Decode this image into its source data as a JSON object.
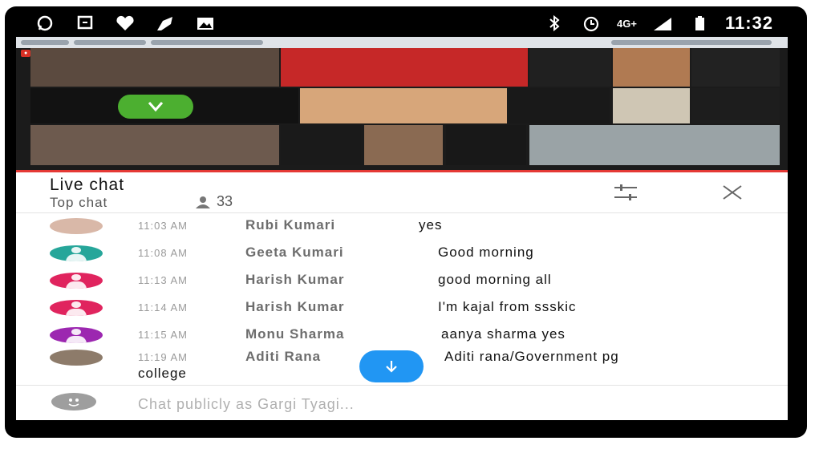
{
  "status_bar": {
    "time": "11:32",
    "network": "4G+",
    "left_icons": [
      "whatsapp-icon",
      "message-icon",
      "heart-icon",
      "cleaner-icon",
      "gallery-icon"
    ],
    "right_icons": [
      "bluetooth-icon",
      "alarm-icon",
      "signal-icon",
      "battery-icon"
    ]
  },
  "chat": {
    "title": "Live chat",
    "mode": "Top chat",
    "viewer_count": "33",
    "input_placeholder": "Chat publicly as Gargi Tyagi...",
    "messages": [
      {
        "time": "11:03 AM",
        "author": "Rubi Kumari",
        "text": "yes",
        "avatar_color": "#d9b8a8"
      },
      {
        "time": "11:08 AM",
        "author": "Geeta Kumari",
        "text": "Good morning",
        "avatar_color": "#26a69a"
      },
      {
        "time": "11:13 AM",
        "author": "Harish Kumar",
        "text": "good morning all",
        "avatar_color": "#e0245e"
      },
      {
        "time": "11:14 AM",
        "author": "Harish Kumar",
        "text": "I'm kajal from ssskic",
        "avatar_color": "#e0245e"
      },
      {
        "time": "11:15 AM",
        "author": "Monu Sharma",
        "text": "aanya sharma yes",
        "avatar_color": "#9c27b0"
      },
      {
        "time": "11:19 AM",
        "author": "Aditi Rana",
        "text": "Aditi rana/Government pg",
        "text_cont": "college",
        "avatar_color": "#8d7b6a"
      }
    ]
  },
  "colors": {
    "accent_red": "#e53935",
    "collapse_green": "#4caf30",
    "scroll_blue": "#2196f3"
  }
}
